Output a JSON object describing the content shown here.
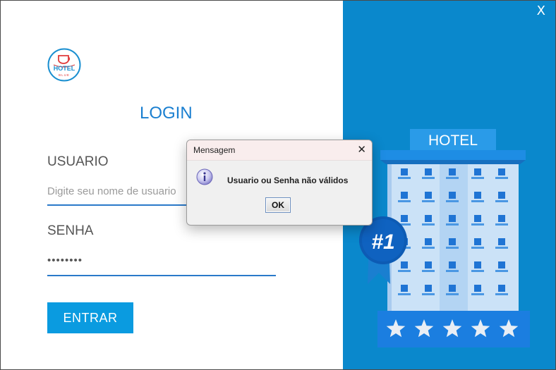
{
  "window": {
    "close_label": "X",
    "accent_color": "#0a88cc"
  },
  "logo": {
    "text": "HOTEL",
    "subtext": "BLUE",
    "icon": "hotel-cup-logo-icon"
  },
  "login": {
    "title": "LOGIN",
    "user_label": "USUARIO",
    "user_placeholder": "Digite seu nome de usuario",
    "user_value": "",
    "pass_label": "SENHA",
    "pass_value": "••••••••",
    "submit_label": "ENTRAR"
  },
  "illustration": {
    "sign": "HOTEL",
    "badge": "#1",
    "stars": 5,
    "icon": "hotel-building-illustration"
  },
  "dialog": {
    "title": "Mensagem",
    "close_label": "✕",
    "icon": "info-icon",
    "message": "Usuario ou Senha não válidos",
    "ok_label": "OK"
  }
}
